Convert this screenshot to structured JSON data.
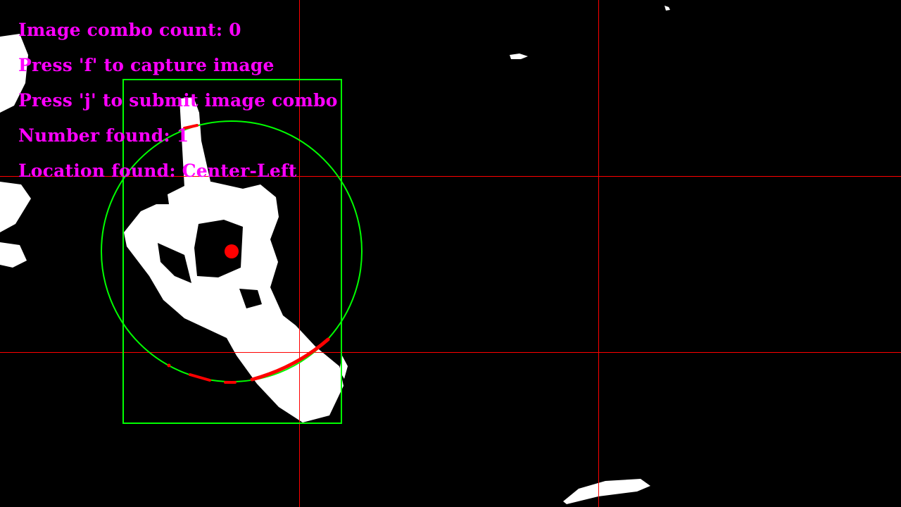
{
  "overlay": {
    "combo_count": "Image combo count: 0",
    "capture_hint": "Press 'f' to capture image",
    "submit_hint": "Press 'j' to submit image combo",
    "number_found": "Number found: 1",
    "location_found": "Location found: Center-Left"
  },
  "colors": {
    "background": "#000000",
    "text": "#ff00ff",
    "grid_lines": "#ff0000",
    "bounding_box": "#00ff00",
    "circle": "#00ff00",
    "center_marker": "#ff0000",
    "hull_defects": "#ff0000",
    "mask": "#ffffff"
  }
}
